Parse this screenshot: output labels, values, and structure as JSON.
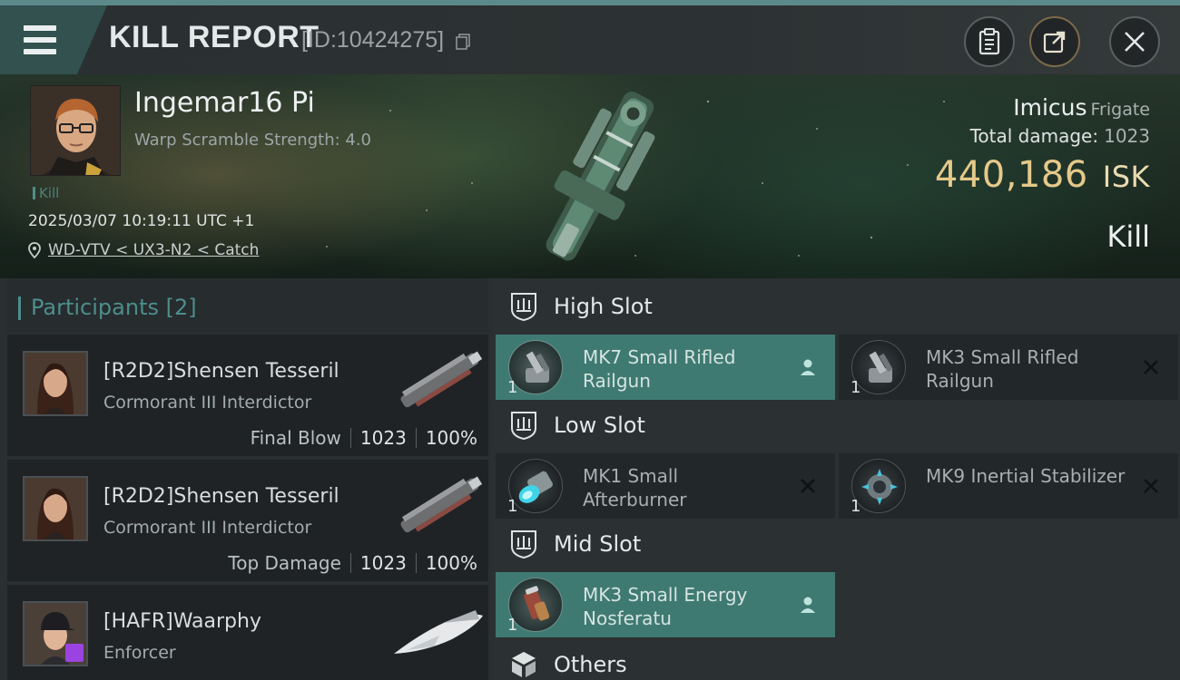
{
  "header": {
    "title": "KILL REPORT",
    "report_id": "[ID:10424275]"
  },
  "victim": {
    "name": "Ingemar16 Pi",
    "warp_scramble": "Warp Scramble Strength: 4.0",
    "kill_tag": "Kill",
    "datetime": "2025/03/07 10:19:11 UTC +1",
    "location": "WD-VTV < UX3-N2 < Catch",
    "ship": "Imicus",
    "ship_class": "Frigate",
    "total_damage_label": "Total damage:",
    "total_damage": "1023",
    "isk_value": "440,186",
    "isk_unit": "ISK",
    "result": "Kill"
  },
  "participants": {
    "title": "Participants [2]",
    "rows": [
      {
        "name": "[R2D2]Shensen Tesseril",
        "ship": "Cormorant III Interdictor",
        "tag": "Final Blow",
        "damage": "1023",
        "percent": "100%"
      },
      {
        "name": "[R2D2]Shensen Tesseril",
        "ship": "Cormorant III Interdictor",
        "tag": "Top Damage",
        "damage": "1023",
        "percent": "100%"
      },
      {
        "name": "[HAFR]Waarphy",
        "ship": "Enforcer"
      }
    ]
  },
  "slots": {
    "high": {
      "title": "High Slot",
      "modules": [
        {
          "qty": "1",
          "name": "MK7 Small Rifled Railgun",
          "state": "user-icon"
        },
        {
          "qty": "1",
          "name": "MK3 Small Rifled Railgun",
          "state": "close-icon"
        }
      ]
    },
    "low": {
      "title": "Low Slot",
      "modules": [
        {
          "qty": "1",
          "name": "MK1 Small Afterburner",
          "state": "close-icon"
        },
        {
          "qty": "1",
          "name": "MK9 Inertial Stabilizer",
          "state": "close-icon"
        }
      ]
    },
    "mid": {
      "title": "Mid Slot",
      "modules": [
        {
          "qty": "1",
          "name": "MK3 Small Energy Nosferatu",
          "state": "user-icon"
        }
      ]
    },
    "others": {
      "title": "Others"
    }
  },
  "colors": {
    "accent_teal": "#4c8e8c",
    "active_module": "#3f7a72",
    "isk_gold": "#e5c98a"
  }
}
